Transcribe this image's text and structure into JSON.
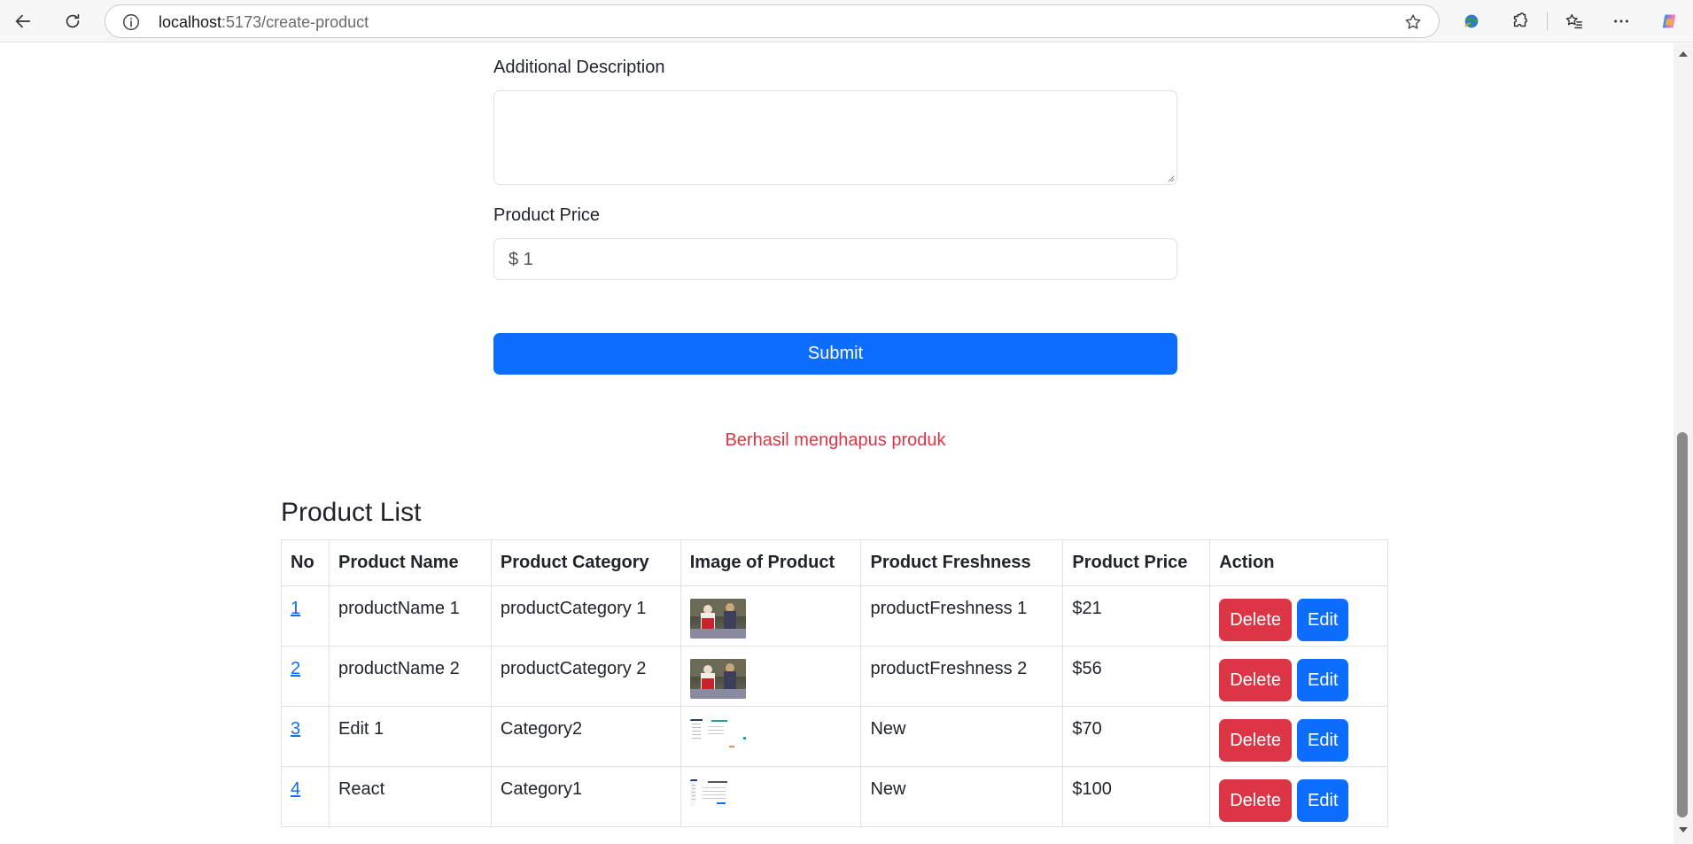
{
  "browser": {
    "url_host": "localhost",
    "url_path": ":5173/create-product"
  },
  "form": {
    "description_label": "Additional Description",
    "description_value": "",
    "price_label": "Product Price",
    "price_value": "$ 1",
    "submit_label": "Submit"
  },
  "alert": {
    "message": "Berhasil menghapus produk",
    "color": "#dc3545"
  },
  "product_list": {
    "title": "Product List",
    "columns": [
      "No",
      "Product Name",
      "Product Category",
      "Image of Product",
      "Product Freshness",
      "Product Price",
      "Action"
    ],
    "rows": [
      {
        "no": "1",
        "name": "productName 1",
        "category": "productCategory 1",
        "image": "photo-thumbnail",
        "freshness": "productFreshness 1",
        "price": "$21",
        "delete": "Delete",
        "edit": "Edit"
      },
      {
        "no": "2",
        "name": "productName 2",
        "category": "productCategory 2",
        "image": "photo-thumbnail",
        "freshness": "productFreshness 2",
        "price": "$56",
        "delete": "Delete",
        "edit": "Edit"
      },
      {
        "no": "3",
        "name": "Edit 1",
        "category": "Category2",
        "image": "screenshot-thumbnail",
        "freshness": "New",
        "price": "$70",
        "delete": "Delete",
        "edit": "Edit"
      },
      {
        "no": "4",
        "name": "React",
        "category": "Category1",
        "image": "screenshot-thumbnail",
        "freshness": "New",
        "price": "$100",
        "delete": "Delete",
        "edit": "Edit"
      }
    ]
  },
  "colors": {
    "primary": "#0d6efd",
    "danger": "#dc3545"
  }
}
